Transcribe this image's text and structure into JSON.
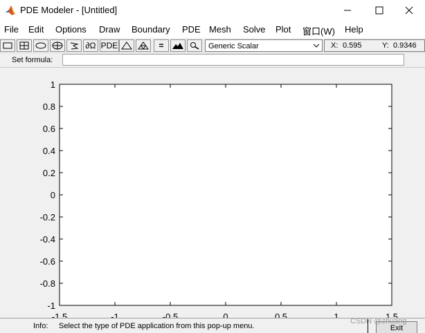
{
  "window": {
    "title": "PDE Modeler - [Untitled]",
    "controls": {
      "minimize": "minimize",
      "maximize": "maximize",
      "close": "close"
    }
  },
  "menu": [
    "File",
    "Edit",
    "Options",
    "Draw",
    "Boundary",
    "PDE",
    "Mesh",
    "Solve",
    "Plot",
    "窗口(W)",
    "Help"
  ],
  "toolbar": {
    "tools": [
      {
        "name": "rectangle-icon",
        "text": ""
      },
      {
        "name": "rectangle-center-icon",
        "text": ""
      },
      {
        "name": "ellipse-icon",
        "text": ""
      },
      {
        "name": "ellipse-center-icon",
        "text": ""
      },
      {
        "name": "polygon-icon",
        "text": ""
      },
      {
        "name": "boundary-mode-button",
        "text": "∂Ω"
      },
      {
        "name": "pde-spec-button",
        "text": "PDE"
      },
      {
        "name": "init-mesh-icon",
        "text": ""
      },
      {
        "name": "refine-mesh-icon",
        "text": ""
      },
      {
        "name": "solve-pde-button",
        "text": "="
      },
      {
        "name": "plot-solution-icon",
        "text": ""
      },
      {
        "name": "zoom-icon",
        "text": ""
      }
    ],
    "app_mode": "Generic Scalar"
  },
  "coords": {
    "x_label": "X:",
    "x_value": "0.595",
    "y_label": "Y:",
    "y_value": "0.9346"
  },
  "formula": {
    "label": "Set formula:",
    "value": ""
  },
  "axes": {
    "xlim": [
      -1.5,
      1.5
    ],
    "ylim": [
      -1,
      1
    ],
    "x_ticks": [
      -1.5,
      -1,
      -0.5,
      0,
      0.5,
      1,
      1.5
    ],
    "y_ticks": [
      -1,
      -0.8,
      -0.6,
      -0.4,
      -0.2,
      0,
      0.2,
      0.4,
      0.6,
      0.8,
      1
    ],
    "x_tick_labels": [
      "-1.5",
      "-1",
      "-0.5",
      "0",
      "0.5",
      "1",
      "1.5"
    ],
    "y_tick_labels": [
      "-1",
      "-0.8",
      "-0.6",
      "-0.4",
      "-0.2",
      "0",
      "0.2",
      "0.4",
      "0.6",
      "0.8",
      "1"
    ]
  },
  "status": {
    "info_label": "Info:",
    "info_text": "Select the type of PDE application from this pop-up menu.",
    "exit_label": "Exit"
  },
  "watermark": "CSDN @zhuang"
}
